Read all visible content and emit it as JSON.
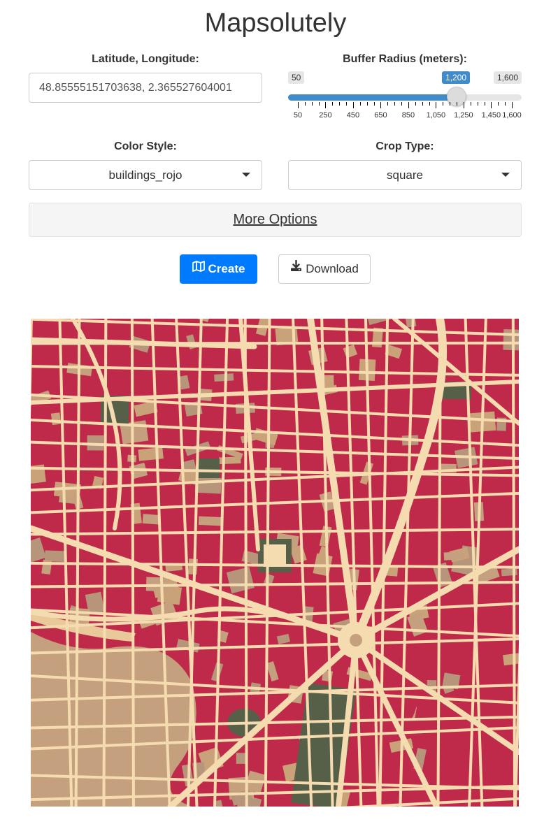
{
  "app": {
    "title": "Mapsolutely"
  },
  "location": {
    "label": "Latitude, Longitude:",
    "value": "48.85555151703638, 2.365527604001"
  },
  "buffer": {
    "label": "Buffer Radius (meters):",
    "min_label": "50",
    "max_label": "1,600",
    "current_label": "1,200",
    "min": 50,
    "max": 1600,
    "value": 1200,
    "ticks": [
      "50",
      "250",
      "450",
      "650",
      "850",
      "1,050",
      "1,250",
      "1,450",
      "1,600"
    ],
    "tick_values": [
      50,
      250,
      450,
      650,
      850,
      1050,
      1250,
      1450,
      1600
    ]
  },
  "color_style": {
    "label": "Color Style:",
    "value": "buildings_rojo"
  },
  "crop_type": {
    "label": "Crop Type:",
    "value": "square"
  },
  "more_options": {
    "label": "More Options"
  },
  "actions": {
    "create_label": "Create",
    "download_label": "Download"
  },
  "icons": {
    "create": "map-icon",
    "download": "download-icon"
  },
  "colors": {
    "accent": "#007bff",
    "slider": "#428bca",
    "map_roads": "#f5dcb0",
    "map_buildings": "#c02a4a",
    "map_water": "#c4a07e",
    "map_parks": "#566049",
    "map_other": "#c9a27a"
  }
}
